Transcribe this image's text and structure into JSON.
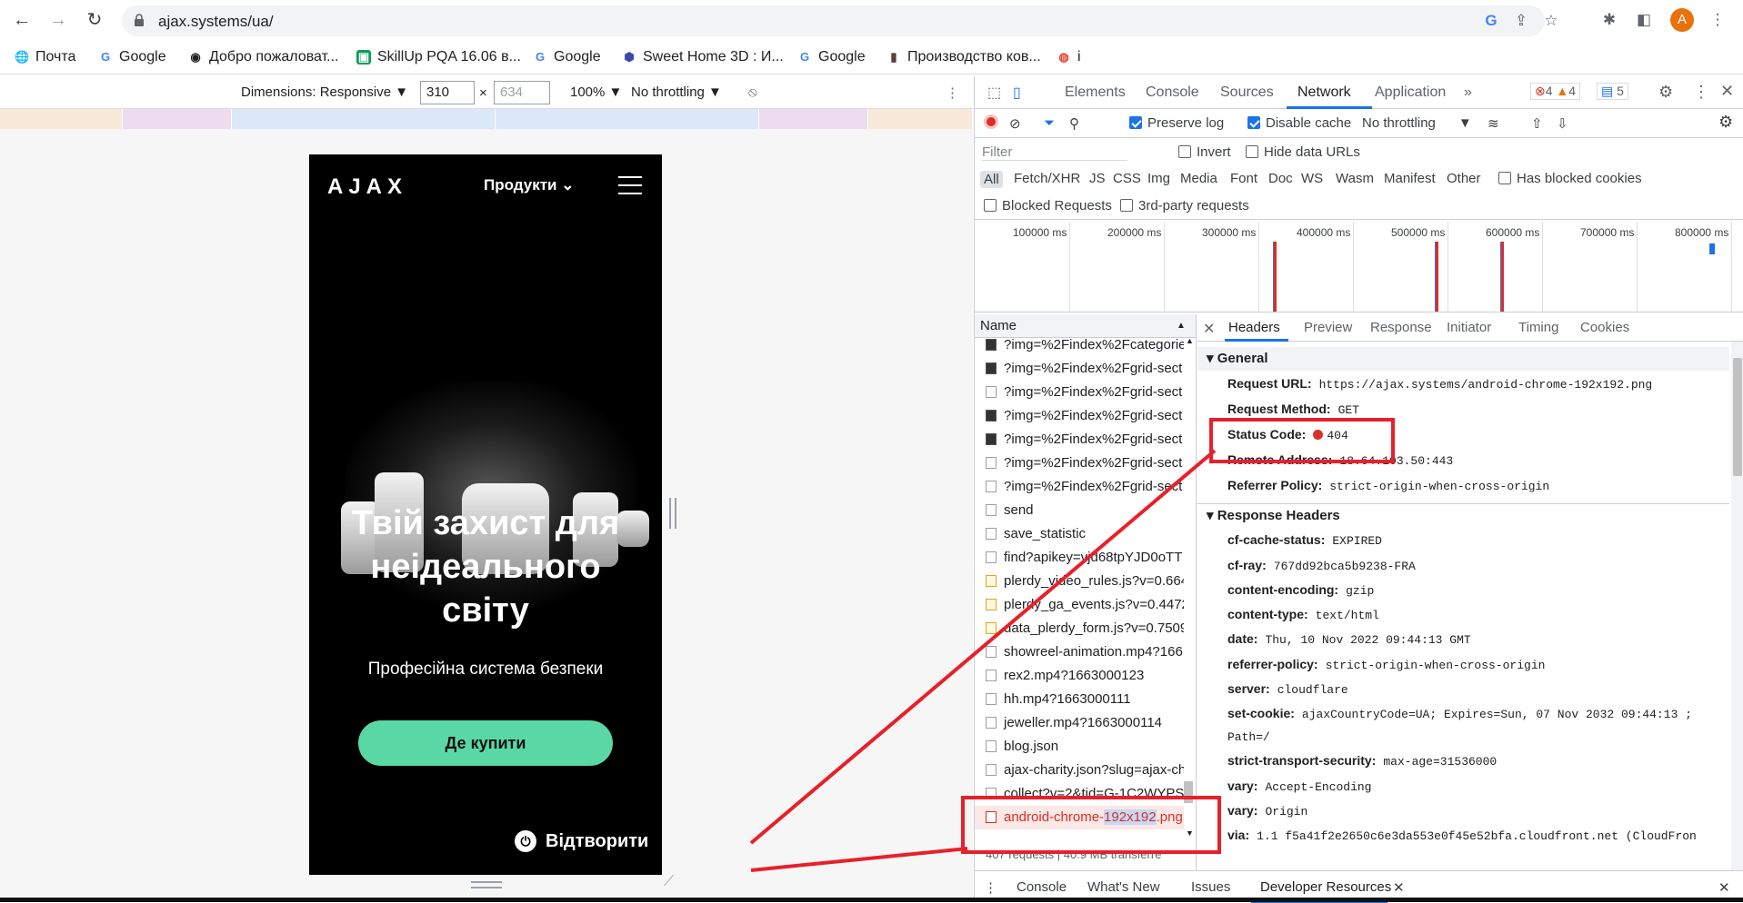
{
  "browser": {
    "url": "ajax.systems/ua/",
    "profile_initial": "A",
    "bookmarks": [
      {
        "label": "Почта",
        "icon": "globe-icon"
      },
      {
        "label": "Google",
        "icon": "google-icon"
      },
      {
        "label": "Добро пожаловат...",
        "icon": "globe-icon"
      },
      {
        "label": "SkillUp PQA 16.06 в...",
        "icon": "classroom-icon"
      },
      {
        "label": "Google",
        "icon": "google-icon"
      },
      {
        "label": "Sweet Home 3D : И...",
        "icon": "sweethome-icon"
      },
      {
        "label": "Google",
        "icon": "google-icon"
      },
      {
        "label": "Производство ков...",
        "icon": "site-icon"
      },
      {
        "label": "i",
        "icon": "colorful-icon"
      }
    ]
  },
  "device_toolbar": {
    "dimensions_label": "Dimensions: Responsive ▼",
    "width": "310",
    "times": "×",
    "height_placeholder": "634",
    "zoom": "100% ▼",
    "throttle": "No throttling ▼"
  },
  "phone": {
    "logo": "AJAX",
    "menu_label": "Продукти",
    "hero_title_line1": "Твій захист для",
    "hero_title_line2": "неідеального",
    "hero_title_line3": "світу",
    "subtitle": "Професійна система безпеки",
    "cta": "Де купити",
    "play": "Відтворити"
  },
  "devtools": {
    "tabs": [
      "Elements",
      "Console",
      "Sources",
      "Network",
      "Application",
      "»"
    ],
    "active_tab": "Network",
    "errors": "4",
    "warnings": "4",
    "messages": "5",
    "preserve_log": "Preserve log",
    "disable_cache": "Disable cache",
    "throttling": "No throttling",
    "filter_placeholder": "Filter",
    "invert": "Invert",
    "hide_data_urls": "Hide data URLs",
    "types": [
      "All",
      "Fetch/XHR",
      "JS",
      "CSS",
      "Img",
      "Media",
      "Font",
      "Doc",
      "WS",
      "Wasm",
      "Manifest",
      "Other"
    ],
    "has_blocked_cookies": "Has blocked cookies",
    "blocked_requests": "Blocked Requests",
    "third_party": "3rd-party requests",
    "timeline_ticks": [
      "100000 ms",
      "200000 ms",
      "300000 ms",
      "400000 ms",
      "500000 ms",
      "600000 ms",
      "700000 ms",
      "800000 ms"
    ],
    "name_header": "Name",
    "requests": [
      {
        "name": "?img=%2Findex%2Fcategorie",
        "type": "img"
      },
      {
        "name": "?img=%2Findex%2Fgrid-sect",
        "type": "img"
      },
      {
        "name": "?img=%2Findex%2Fgrid-sect",
        "type": "img"
      },
      {
        "name": "?img=%2Findex%2Fgrid-sect",
        "type": "img"
      },
      {
        "name": "?img=%2Findex%2Fgrid-sect",
        "type": "img"
      },
      {
        "name": "?img=%2Findex%2Fgrid-sect",
        "type": "img"
      },
      {
        "name": "?img=%2Findex%2Fgrid-sect",
        "type": "img"
      },
      {
        "name": "send",
        "type": "doc"
      },
      {
        "name": "save_statistic",
        "type": "doc"
      },
      {
        "name": "find?apikey=vjd68tpYJD0oTT",
        "type": "doc"
      },
      {
        "name": "plerdy_video_rules.js?v=0.664",
        "type": "js"
      },
      {
        "name": "plerdy_ga_events.js?v=0.4472",
        "type": "js"
      },
      {
        "name": "data_plerdy_form.js?v=0.7509",
        "type": "js"
      },
      {
        "name": "showreel-animation.mp4?166",
        "type": "doc"
      },
      {
        "name": "rex2.mp4?1663000123",
        "type": "doc"
      },
      {
        "name": "hh.mp4?1663000111",
        "type": "doc"
      },
      {
        "name": "jeweller.mp4?1663000114",
        "type": "doc"
      },
      {
        "name": "blog.json",
        "type": "doc"
      },
      {
        "name": "ajax-charity.json?slug=ajax-ch",
        "type": "doc"
      },
      {
        "name": "collect?v=2&tid=G-1C2WYPS",
        "type": "doc"
      }
    ],
    "error_request_prefix": "android-chrome-",
    "error_request_highlight": "192x192",
    "error_request_suffix": ".png",
    "status_bar": "407 requests | 40.9 MB transferre",
    "detail_tabs": [
      "Headers",
      "Preview",
      "Response",
      "Initiator",
      "Timing",
      "Cookies"
    ],
    "general_title": "General",
    "general": [
      {
        "key": "Request URL:",
        "value": "https://ajax.systems/android-chrome-192x192.png"
      },
      {
        "key": "Request Method:",
        "value": "GET"
      },
      {
        "key": "Status Code:",
        "value": "404"
      },
      {
        "key": "Remote Address:",
        "value": "18.64.103.50:443"
      },
      {
        "key": "Referrer Policy:",
        "value": "strict-origin-when-cross-origin"
      }
    ],
    "response_title": "Response Headers",
    "response_headers": [
      {
        "key": "cf-cache-status:",
        "value": "EXPIRED"
      },
      {
        "key": "cf-ray:",
        "value": "767dd92bca5b9238-FRA"
      },
      {
        "key": "content-encoding:",
        "value": "gzip"
      },
      {
        "key": "content-type:",
        "value": "text/html"
      },
      {
        "key": "date:",
        "value": "Thu, 10 Nov 2022 09:44:13 GMT"
      },
      {
        "key": "referrer-policy:",
        "value": "strict-origin-when-cross-origin"
      },
      {
        "key": "server:",
        "value": "cloudflare"
      },
      {
        "key": "set-cookie:",
        "value": "ajaxCountryCode=UA; Expires=Sun, 07 Nov 2032 09:44:13 ;"
      },
      {
        "key": "",
        "value": "Path=/"
      },
      {
        "key": "strict-transport-security:",
        "value": "max-age=31536000"
      },
      {
        "key": "vary:",
        "value": "Accept-Encoding"
      },
      {
        "key": "vary:",
        "value": "Origin"
      },
      {
        "key": "via:",
        "value": "1.1 f5a41f2e2650c6e3da553e0f45e52bfa.cloudfront.net (CloudFron"
      }
    ],
    "drawer_tabs": [
      "Console",
      "What's New",
      "Issues",
      "Developer Resources"
    ]
  },
  "colors": {
    "accent": "#1a73e8",
    "error": "#d93025",
    "cta": "#59d8a6",
    "annotation": "#e8202a"
  }
}
